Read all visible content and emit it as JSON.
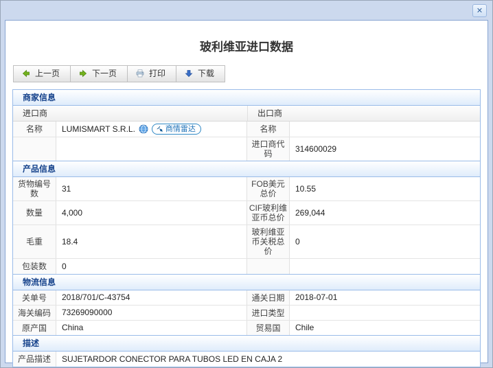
{
  "window": {
    "title": "玻利维亚进口数据",
    "close_glyph": "✕"
  },
  "toolbar": {
    "prev_label": "上一页",
    "next_label": "下一页",
    "print_label": "打印",
    "download_label": "下载"
  },
  "merchant": {
    "header": "商家信息",
    "importer_col": "进口商",
    "exporter_col": "出口商",
    "importer_name_label": "名称",
    "importer_name": "LUMISMART S.R.L.",
    "radar_badge_label": "商情雷达",
    "exporter_name_label": "名称",
    "exporter_name": "",
    "importer_code_label": "进口商代码",
    "importer_code": "314600029"
  },
  "product": {
    "header": "产品信息",
    "rows": [
      {
        "l1": "货物编号数",
        "v1": "31",
        "l2": "FOB美元总价",
        "v2": "10.55"
      },
      {
        "l1": "数量",
        "v1": "4,000",
        "l2": "CIF玻利维亚币总价",
        "v2": "269,044"
      },
      {
        "l1": "毛重",
        "v1": "18.4",
        "l2": "玻利维亚币关税总价",
        "v2": "0"
      },
      {
        "l1": "包装数",
        "v1": "0",
        "l2": "",
        "v2": ""
      }
    ]
  },
  "logistics": {
    "header": "物流信息",
    "rows": [
      {
        "l1": "关单号",
        "v1": "2018/701/C-43754",
        "l2": "通关日期",
        "v2": "2018-07-01"
      },
      {
        "l1": "海关编码",
        "v1": "73269090000",
        "l2": "进口类型",
        "v2": ""
      },
      {
        "l1": "原产国",
        "v1": "China",
        "l2": "贸易国",
        "v2": "Chile"
      }
    ]
  },
  "description": {
    "header": "描述",
    "label": "产品描述",
    "value": "SUJETARDOR CONECTOR PARA TUBOS LED EN CAJA 2"
  },
  "colors": {
    "section_header_text": "#15428b",
    "table_border": "#99bbe8",
    "badge_blue": "#1e72b8",
    "arrow_green": "#74b21c",
    "arrow_blue": "#3a6fc9",
    "window_bg": "#ccd9ee"
  }
}
